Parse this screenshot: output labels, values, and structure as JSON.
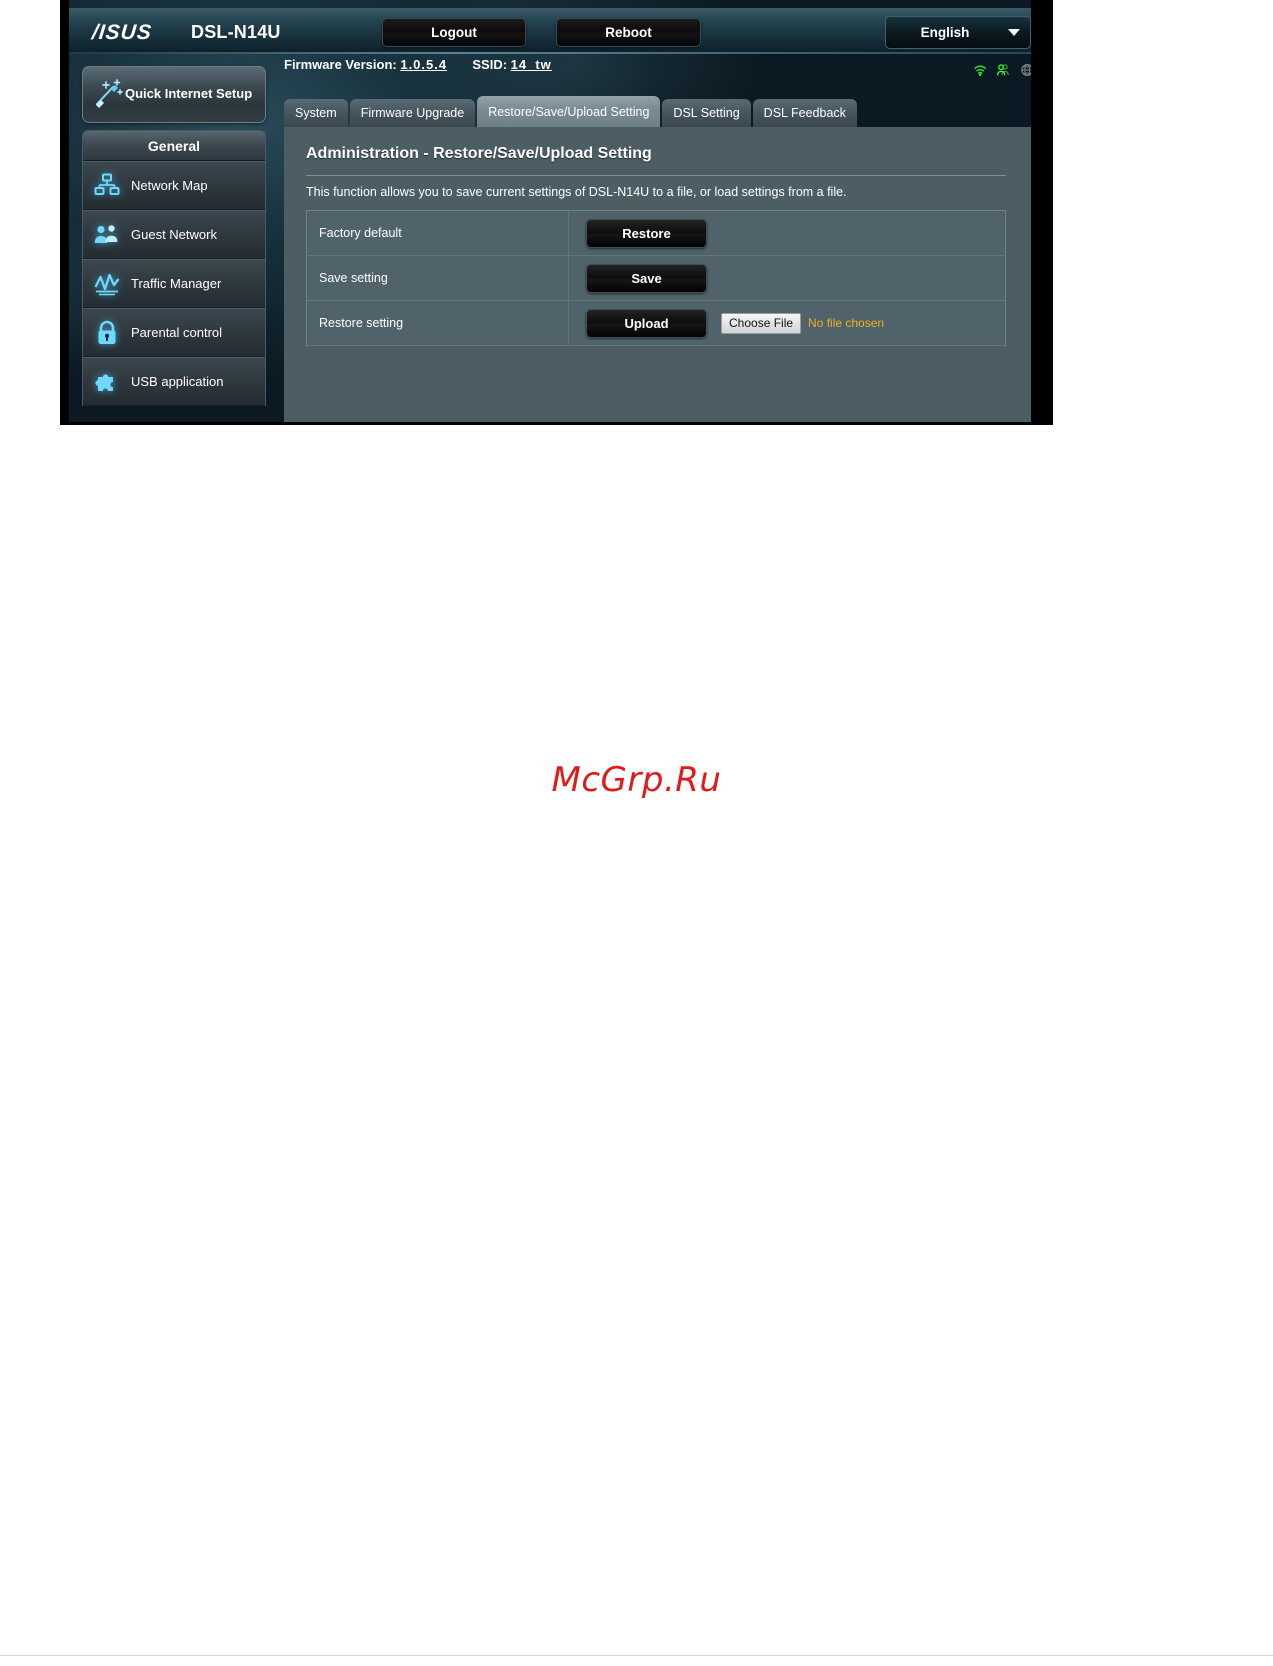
{
  "window": {
    "brand": "/ISUS",
    "model": "DSL-N14U",
    "logout_label": "Logout",
    "reboot_label": "Reboot",
    "language": "English"
  },
  "infobar": {
    "firmware_label": "Firmware Version:",
    "firmware_value": "1.0.5.4",
    "ssid_label": "SSID:",
    "ssid_value": "14_tw",
    "icons": [
      {
        "name": "wifi-status-icon",
        "color": "#33dd33"
      },
      {
        "name": "clients-status-icon",
        "color": "#33dd33"
      },
      {
        "name": "internet-globe-status-icon",
        "color": "#6d7c80"
      },
      {
        "name": "devices-status-icon",
        "color": "#6d7c80"
      },
      {
        "name": "usb-status-icon",
        "color": "#33dd33"
      }
    ]
  },
  "sidebar": {
    "quick_setup_label": "Quick Internet Setup",
    "quick_setup_icon": "magic-wand-icon",
    "section_title": "General",
    "items": [
      {
        "label": "Network Map",
        "icon": "network-map-icon"
      },
      {
        "label": "Guest Network",
        "icon": "guest-network-icon"
      },
      {
        "label": "Traffic Manager",
        "icon": "traffic-manager-icon"
      },
      {
        "label": "Parental control",
        "icon": "parental-control-lock-icon"
      },
      {
        "label": "USB application",
        "icon": "usb-application-puzzle-icon"
      }
    ]
  },
  "tabs": [
    {
      "label": "System",
      "active": false
    },
    {
      "label": "Firmware Upgrade",
      "active": false
    },
    {
      "label": "Restore/Save/Upload Setting",
      "active": true
    },
    {
      "label": "DSL Setting",
      "active": false
    },
    {
      "label": "DSL Feedback",
      "active": false
    }
  ],
  "main": {
    "title": "Administration - Restore/Save/Upload Setting",
    "description": "This function allows you to save current settings of DSL-N14U to a file, or load settings from a file.",
    "rows": [
      {
        "label": "Factory default",
        "button": "Restore",
        "has_file": false
      },
      {
        "label": "Save setting",
        "button": "Save",
        "has_file": false
      },
      {
        "label": "Restore setting",
        "button": "Upload",
        "has_file": true,
        "choose_file_label": "Choose File",
        "file_status": "No file chosen"
      }
    ]
  },
  "watermark": {
    "text": "McGrp.Ru",
    "color": "#e01b1b"
  }
}
